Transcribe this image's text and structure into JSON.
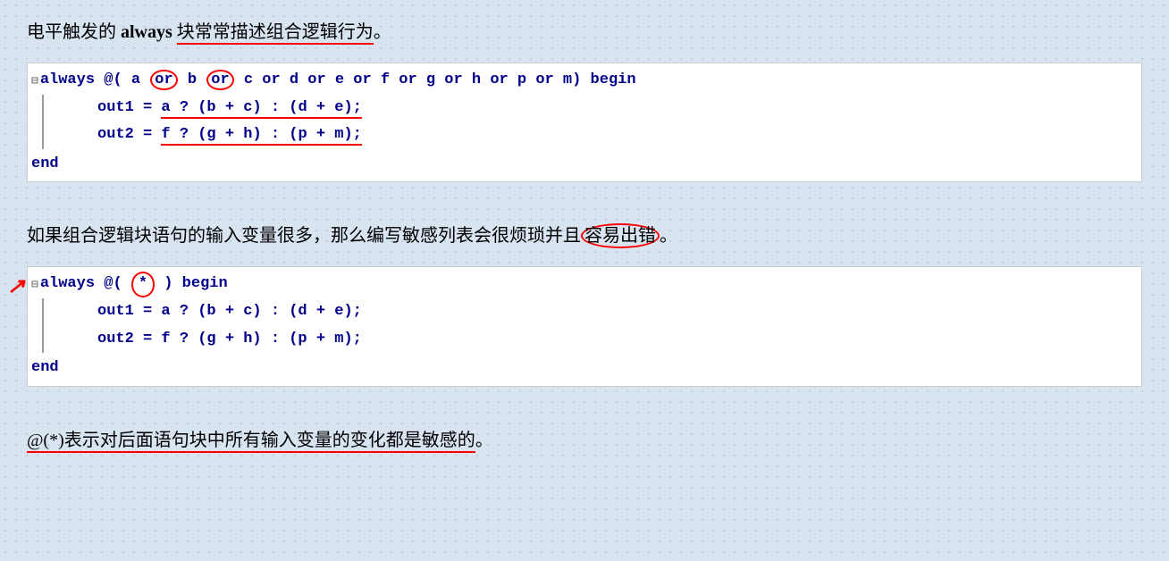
{
  "intro_text": {
    "prefix": "电平触发的 ",
    "keyword": "always",
    "suffix_underlined": "块常常描述组合逻辑行为",
    "suffix_end": "。"
  },
  "code_block_1": {
    "line1": "always @( a or b or c or d or e or f or g or h or p or m) begin",
    "line2": "out1 = a ? (b + c) : (d + e);",
    "line3": "out2 = f ? (g + h) : (p + m);",
    "line4": "end"
  },
  "middle_text": {
    "text_before": "如果组合逻辑块语句的输入变量很多，那么编写敏感列表会很烦琐并且",
    "circled": "容易出错",
    "text_after": "。"
  },
  "code_block_2": {
    "line1_prefix": "always @( ",
    "line1_star_circled": "*",
    "line1_suffix": ") begin",
    "line2": "out1 = a ? (b + c) : (d + e);",
    "line3": "out2 = f ? (g + h) : (p + m);",
    "line4": "end"
  },
  "bottom_text": {
    "prefix_circled": "@(*)表示对后面语句块中所有输入变量",
    "underlined": "的变化都是敏感的",
    "suffix": "。"
  },
  "colors": {
    "code_blue": "#00008b",
    "red": "#cc0000",
    "bg": "#d8e4f0"
  }
}
